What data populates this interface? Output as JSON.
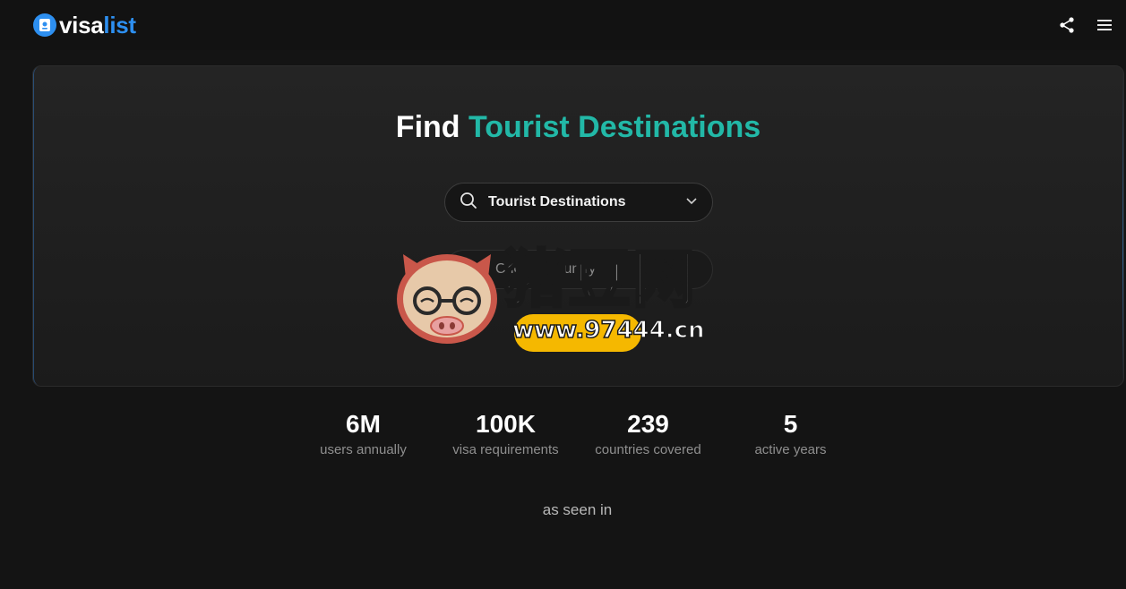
{
  "header": {
    "logo_visa": "visa",
    "logo_list": "list",
    "share_icon": "share-icon",
    "menu_icon": "hamburger-menu-icon"
  },
  "hero": {
    "title_white": "Find",
    "title_accent": "Tourist Destinations",
    "select_value": "Tourist Destinations",
    "country_placeholder": "Choose country",
    "cta_label": ""
  },
  "watermark": {
    "text_cn": "猪豆网",
    "url": "www.97444.cn"
  },
  "stats": [
    {
      "value": "6M",
      "label": "users annually"
    },
    {
      "value": "100K",
      "label": "visa requirements"
    },
    {
      "value": "239",
      "label": "countries covered"
    },
    {
      "value": "5",
      "label": "active years"
    }
  ],
  "as_seen_in": "as seen in",
  "colors": {
    "background": "#141414",
    "brand_blue": "#2d8ff0",
    "accent_teal": "#22b8a7",
    "cta_yellow": "#f5b800"
  }
}
